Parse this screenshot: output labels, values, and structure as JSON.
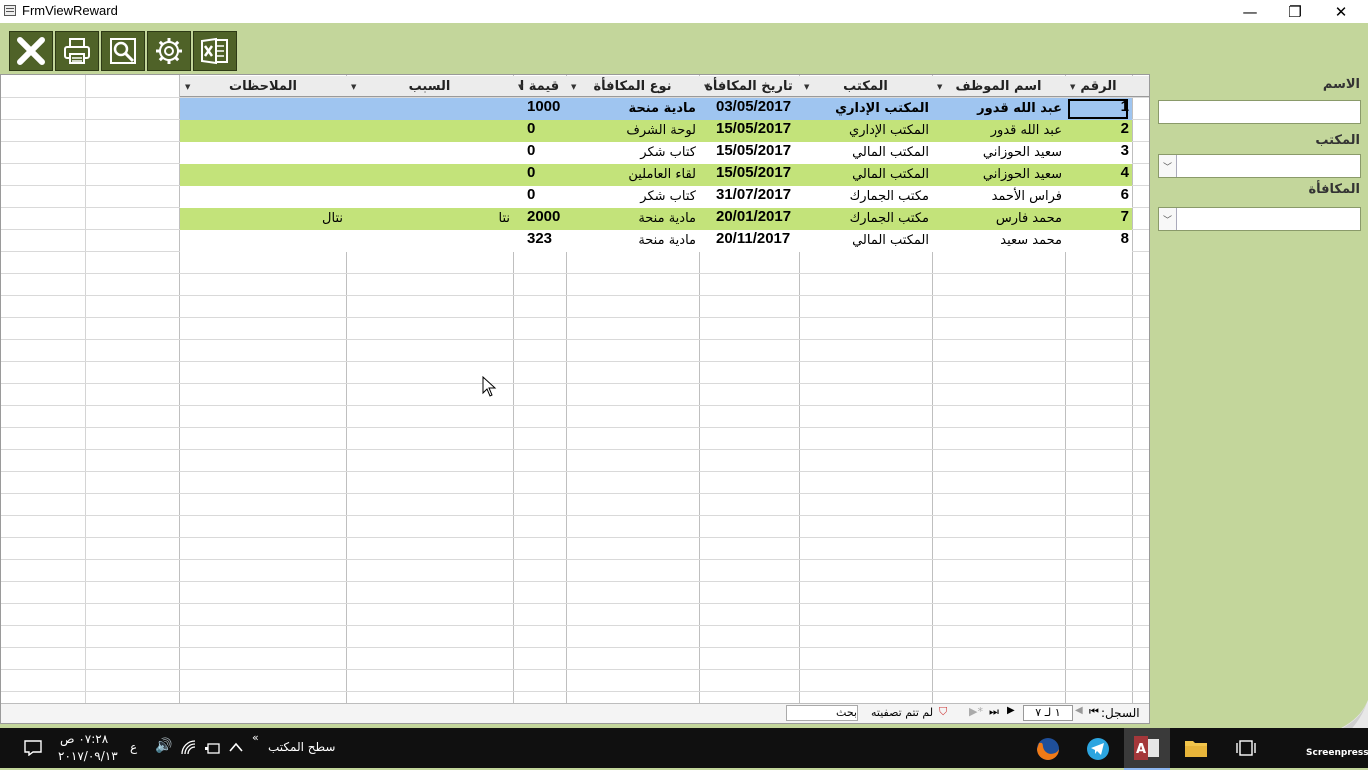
{
  "window": {
    "title": "FrmViewReward",
    "minimize": "—",
    "restore": "❐",
    "close": "✕"
  },
  "toolbar": [
    {
      "name": "close-form-button",
      "icon": "close-x-icon"
    },
    {
      "name": "print-button",
      "icon": "printer-icon"
    },
    {
      "name": "preview-button",
      "icon": "magnifier-icon"
    },
    {
      "name": "settings-button",
      "icon": "gear-icon"
    },
    {
      "name": "export-excel-button",
      "icon": "excel-icon"
    }
  ],
  "table": {
    "headers": {
      "num": "الرقم",
      "employee": "اسم الموظف",
      "office": "المكتب",
      "date": "تاريخ المكافأة",
      "type": "نوع المكافأة",
      "value": "قيمة ا",
      "reason": "السبب",
      "notes": "الملاحظات"
    },
    "rows": [
      {
        "num": "1",
        "employee": "عبد الله قدور",
        "office": "المكتب الإداري",
        "date": "03/05/2017",
        "type": "مادية منحة",
        "value": "1000",
        "reason": "",
        "notes": ""
      },
      {
        "num": "2",
        "employee": "عبد الله قدور",
        "office": "المكتب الإداري",
        "date": "15/05/2017",
        "type": "لوحة الشرف",
        "value": "0",
        "reason": "",
        "notes": ""
      },
      {
        "num": "3",
        "employee": "سعيد الحوزاني",
        "office": "المكتب المالي",
        "date": "15/05/2017",
        "type": "كتاب شكر",
        "value": "0",
        "reason": "",
        "notes": ""
      },
      {
        "num": "4",
        "employee": "سعيد الحوزاني",
        "office": "المكتب المالي",
        "date": "15/05/2017",
        "type": "لقاء العاملين",
        "value": "0",
        "reason": "",
        "notes": ""
      },
      {
        "num": "6",
        "employee": "فراس الأحمد",
        "office": "مكتب الجمارك",
        "date": "31/07/2017",
        "type": "كتاب شكر",
        "value": "0",
        "reason": "",
        "notes": ""
      },
      {
        "num": "7",
        "employee": "محمد فارس",
        "office": "مكتب الجمارك",
        "date": "20/01/2017",
        "type": "مادية منحة",
        "value": "2000",
        "reason": "نتا",
        "notes": "نتال"
      },
      {
        "num": "8",
        "employee": "محمد سعيد",
        "office": "المكتب المالي",
        "date": "20/11/2017",
        "type": "مادية منحة",
        "value": "323",
        "reason": "",
        "notes": ""
      }
    ]
  },
  "statusbar": {
    "record_label": "السجل:",
    "record_value": "١ لـ ٧",
    "filter_label": "لم تتم تصفيته",
    "search_placeholder": "بحث"
  },
  "sidebar": {
    "name_label": "الاسم",
    "office_label": "المكتب",
    "reward_label": "المكافأة",
    "name_value": "",
    "office_value": "",
    "reward_value": ""
  },
  "taskbar": {
    "time": "٠٧:٢٨ ص",
    "date": "٢٠١٧/٠٩/١٣",
    "lang": "ع",
    "desktop_label": "سطح المكتب",
    "chevron": "«",
    "watermark": "Screenpresso"
  },
  "colors": {
    "accent_green": "#c3d69b",
    "row_green": "#c3e37a",
    "selected_blue": "#9fc5f0",
    "toolbar_dark": "#4f6228"
  }
}
